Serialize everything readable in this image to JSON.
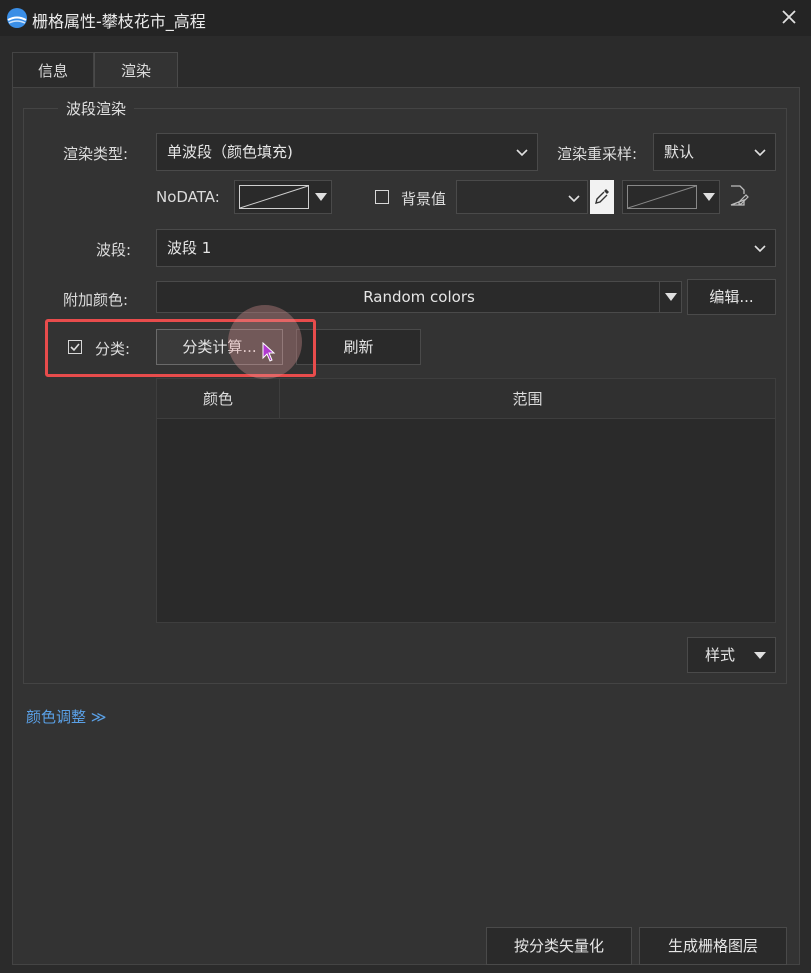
{
  "window": {
    "title": "栅格属性-攀枝花市_高程",
    "icon": "app-logo-icon"
  },
  "tabs": [
    {
      "label": "信息",
      "active": false
    },
    {
      "label": "渲染",
      "active": true
    }
  ],
  "group": {
    "title": "波段渲染"
  },
  "render_type": {
    "label": "渲染类型:",
    "value": "单波段（颜色填充)"
  },
  "resample": {
    "label": "渲染重采样:",
    "value": "默认"
  },
  "nodata": {
    "label": "NoDATA:"
  },
  "background": {
    "label": "背景值",
    "checked": false
  },
  "band": {
    "label": "波段:",
    "value": "波段 1"
  },
  "extra_color": {
    "label": "附加颜色:",
    "value": "Random colors",
    "edit_label": "编辑..."
  },
  "classify": {
    "label": "分类:",
    "checked": true,
    "compute_label": "分类计算...",
    "refresh_label": "刷新"
  },
  "table": {
    "columns": [
      "颜色",
      "范围"
    ],
    "rows": []
  },
  "style_button": {
    "label": "样式"
  },
  "color_adjust": {
    "label": "颜色调整 ≫"
  },
  "footer": {
    "vectorize_label": "按分类矢量化",
    "generate_label": "生成栅格图层"
  },
  "colors": {
    "highlight": "#e84c4c",
    "link": "#5aa0e6",
    "background": "#2b2b2b"
  }
}
